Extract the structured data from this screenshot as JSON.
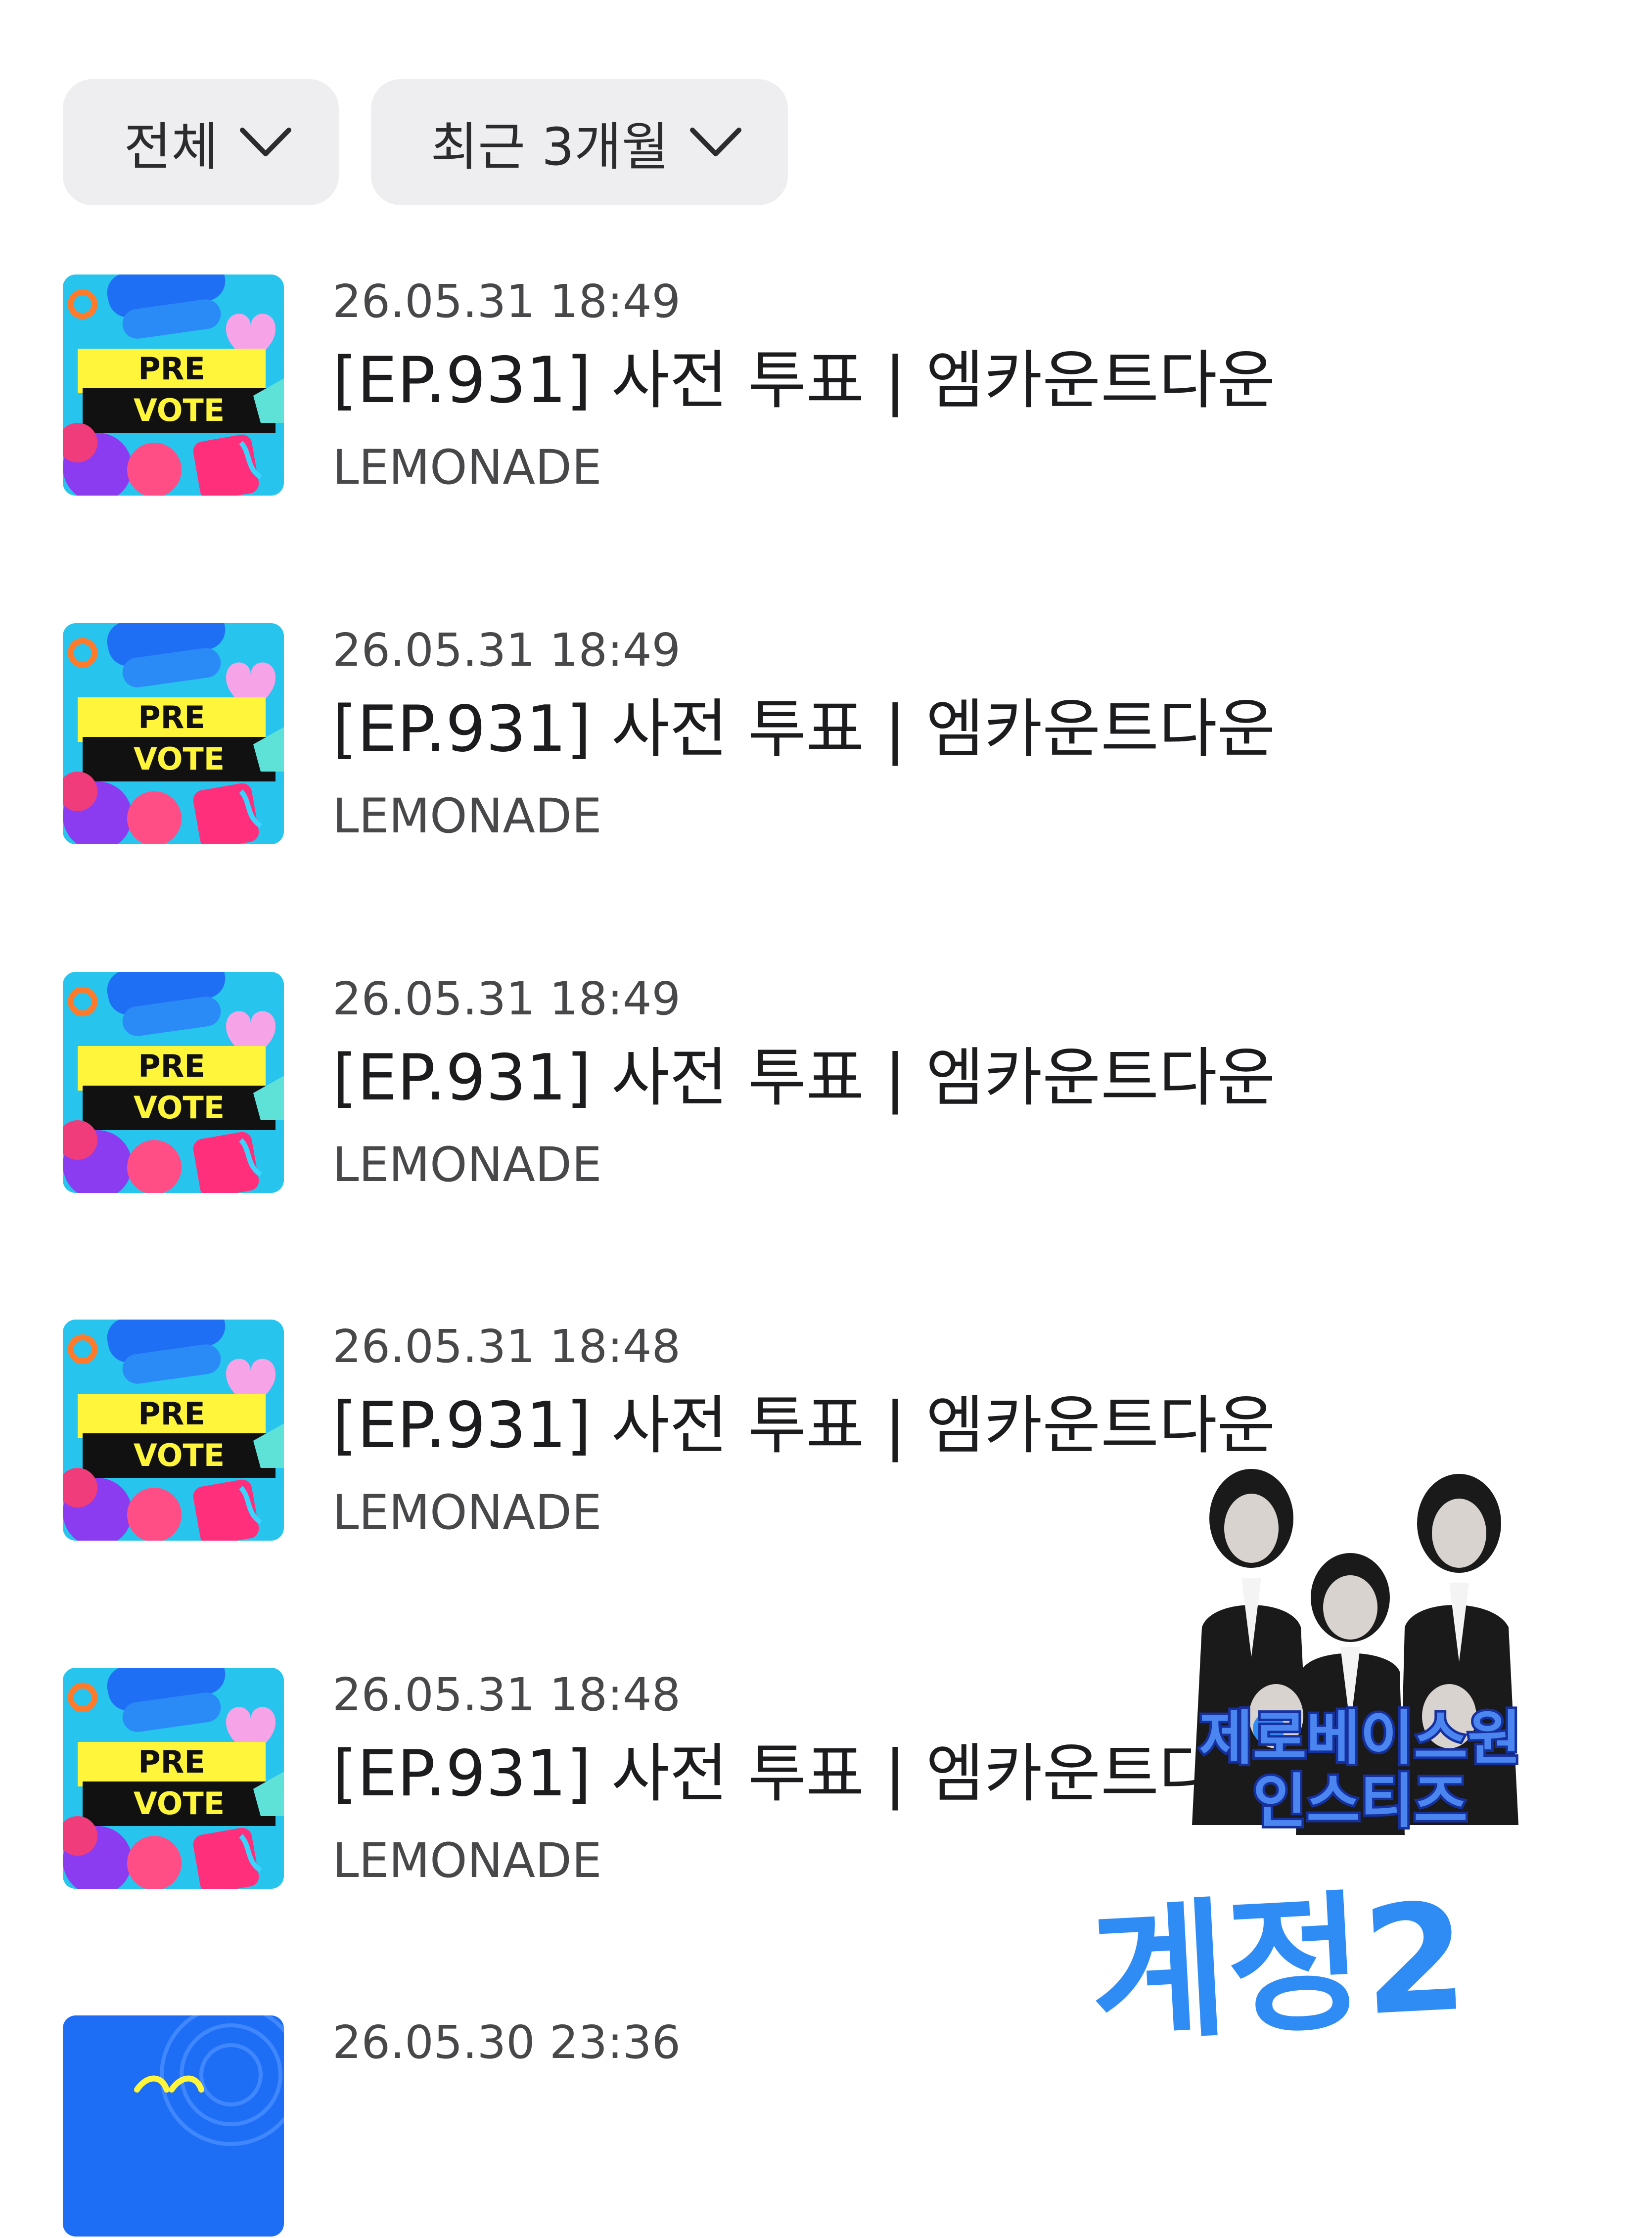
{
  "filters": {
    "type_label": "전체",
    "period_label": "최근 3개월"
  },
  "thumbnail": {
    "line1": "PRE",
    "line2": "VOTE"
  },
  "items": [
    {
      "date": "26.05.31 18:49",
      "title": "[EP.931] 사전 투표 | 엠카운트다운",
      "channel": "LEMONADE"
    },
    {
      "date": "26.05.31 18:49",
      "title": "[EP.931] 사전 투표 | 엠카운트다운",
      "channel": "LEMONADE"
    },
    {
      "date": "26.05.31 18:49",
      "title": "[EP.931] 사전 투표 | 엠카운트다운",
      "channel": "LEMONADE"
    },
    {
      "date": "26.05.31 18:48",
      "title": "[EP.931] 사전 투표 | 엠카운트다운",
      "channel": "LEMONADE"
    },
    {
      "date": "26.05.31 18:48",
      "title": "[EP.931] 사전 투표 | 엠카운트다운",
      "channel": "LEMONADE"
    },
    {
      "date": "26.05.30 23:36",
      "title": "",
      "channel": ""
    }
  ],
  "overlay": {
    "sticker_line1": "제로베이스원",
    "sticker_line2": "인스티즈",
    "handwriting": "계정2"
  },
  "colors": {
    "chip_bg": "#eeeef0",
    "thumb_blue": "#1e6ef5",
    "thumb_yellow": "#fff53a",
    "sticker_blue": "#4b86f0",
    "handwriting_blue": "#2f8cf5"
  },
  "icons": {
    "chip_dropdown": "chevron-down-icon"
  }
}
